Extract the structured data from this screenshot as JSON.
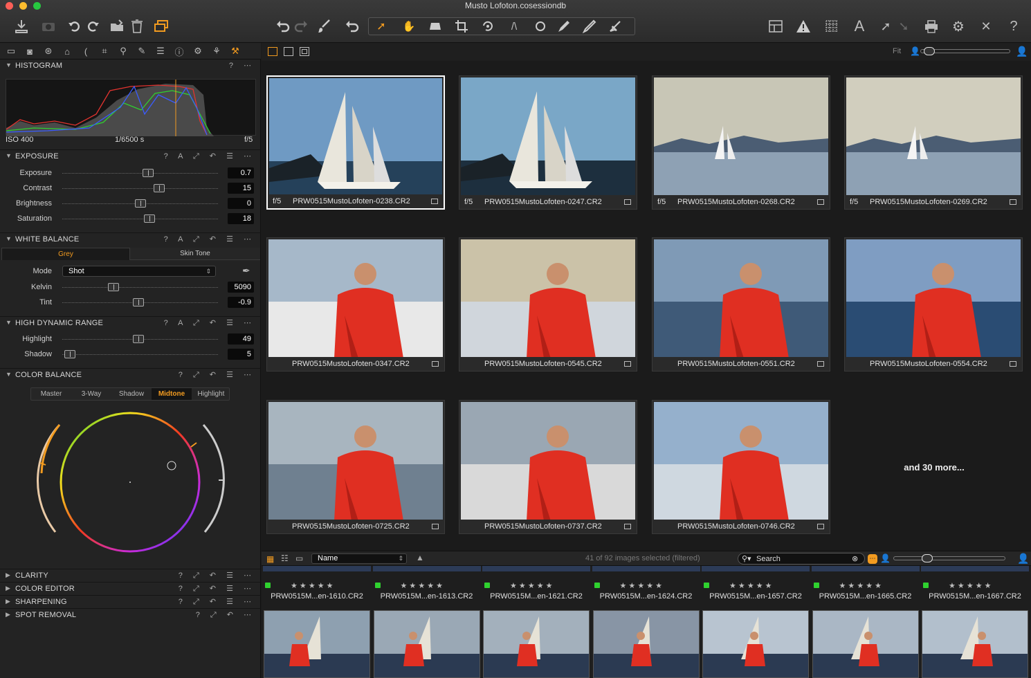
{
  "window": {
    "title": "Musto Lofoton.cosessiondb"
  },
  "histogram": {
    "title": "HISTOGRAM",
    "iso": "ISO 400",
    "shutter": "1/6500 s",
    "aperture": "f/5"
  },
  "exposure": {
    "title": "EXPOSURE",
    "rows": [
      {
        "label": "Exposure",
        "value": "0.7",
        "pos": 0.55
      },
      {
        "label": "Contrast",
        "value": "15",
        "pos": 0.62
      },
      {
        "label": "Brightness",
        "value": "0",
        "pos": 0.5
      },
      {
        "label": "Saturation",
        "value": "18",
        "pos": 0.56
      }
    ]
  },
  "white_balance": {
    "title": "WHITE BALANCE",
    "tabs": [
      "Grey",
      "Skin Tone"
    ],
    "mode_label": "Mode",
    "mode_value": "Shot",
    "rows": [
      {
        "label": "Kelvin",
        "value": "5090",
        "pos": 0.33
      },
      {
        "label": "Tint",
        "value": "-0.9",
        "pos": 0.49
      }
    ]
  },
  "hdr": {
    "title": "HIGH DYNAMIC RANGE",
    "rows": [
      {
        "label": "Highlight",
        "value": "49",
        "pos": 0.49
      },
      {
        "label": "Shadow",
        "value": "5",
        "pos": 0.05
      }
    ]
  },
  "color_balance": {
    "title": "COLOR BALANCE",
    "tabs": [
      "Master",
      "3-Way",
      "Shadow",
      "Midtone",
      "Highlight"
    ],
    "active_tab": "Midtone"
  },
  "collapsed_sections": [
    "CLARITY",
    "COLOR EDITOR",
    "SHARPENING",
    "SPOT REMOVAL"
  ],
  "viewer": {
    "zoom_label": "Fit",
    "thumbs": [
      {
        "aperture": "f/5",
        "file": "PRW0515MustoLofoten-0238.CR2",
        "selected": true
      },
      {
        "aperture": "f/5",
        "file": "PRW0515MustoLofoten-0247.CR2"
      },
      {
        "aperture": "f/5",
        "file": "PRW0515MustoLofoten-0268.CR2"
      },
      {
        "aperture": "f/5",
        "file": "PRW0515MustoLofoten-0269.CR2"
      },
      {
        "aperture": "",
        "file": "PRW0515MustoLofoten-0347.CR2"
      },
      {
        "aperture": "",
        "file": "PRW0515MustoLofoten-0545.CR2"
      },
      {
        "aperture": "",
        "file": "PRW0515MustoLofoten-0551.CR2"
      },
      {
        "aperture": "",
        "file": "PRW0515MustoLofoten-0554.CR2"
      },
      {
        "aperture": "",
        "file": "PRW0515MustoLofoten-0725.CR2"
      },
      {
        "aperture": "",
        "file": "PRW0515MustoLofoten-0737.CR2"
      },
      {
        "aperture": "",
        "file": "PRW0515MustoLofoten-0746.CR2"
      }
    ],
    "more_text": "and 30 more..."
  },
  "browser": {
    "sort_label": "Name",
    "status": "41 of 92 images selected (filtered)",
    "search_placeholder": "Search"
  },
  "filmstrip": {
    "names": [
      "PRW0515M...en-1610.CR2",
      "PRW0515M...en-1613.CR2",
      "PRW0515M...en-1621.CR2",
      "PRW0515M...en-1624.CR2",
      "PRW0515M...en-1657.CR2",
      "PRW0515M...en-1665.CR2",
      "PRW0515M...en-1667.CR2"
    ],
    "stars": "★ ★ ★ ★ ★"
  }
}
